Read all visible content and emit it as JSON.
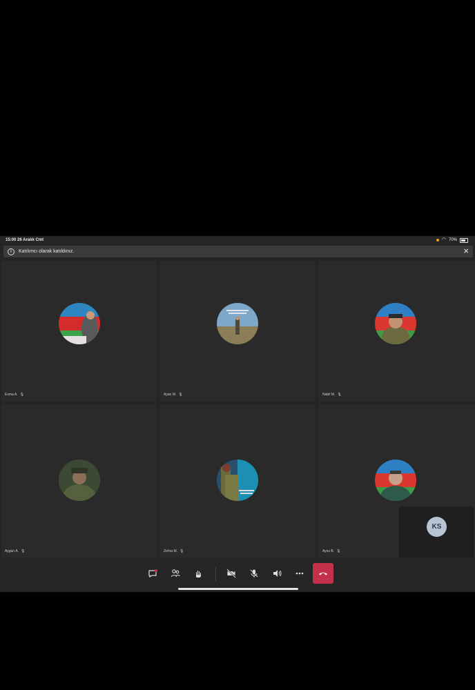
{
  "status_bar": {
    "time_date": "15:00  26 Aralık Cmt",
    "battery": "70%",
    "battery_level": 0.7
  },
  "banner": {
    "message": "Katılımcı olarak katıldınız.",
    "close_icon": "close-icon",
    "info_icon": "info-icon"
  },
  "participants": [
    {
      "name": "Esma A.",
      "avatar": "flag-person-avatar"
    },
    {
      "name": "Ayan M.",
      "avatar": "soldier-field-avatar"
    },
    {
      "name": "Nabil M.",
      "avatar": "soldier-flag-avatar"
    },
    {
      "name": "Aygün A.",
      "avatar": "soldier-camo-avatar"
    },
    {
      "name": "Zehra M.",
      "avatar": "soldier-text-avatar"
    },
    {
      "name": "Aysu B.",
      "avatar": "officer-avatar"
    }
  ],
  "self_view": {
    "initials": "KS"
  },
  "toolbar": {
    "buttons": [
      "chat-icon",
      "participants-icon",
      "raise-hand-icon",
      "camera-off-icon",
      "mic-off-icon",
      "speaker-icon",
      "more-icon",
      "hang-up-icon"
    ],
    "hangup_color": "#c4314b"
  }
}
